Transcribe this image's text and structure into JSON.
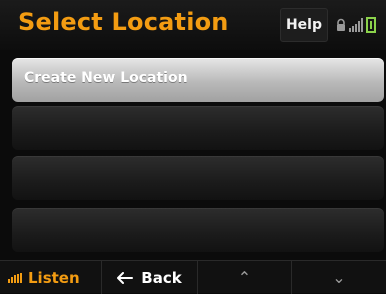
{
  "header": {
    "title": "Select Location",
    "help_label": "Help",
    "status_icons": [
      "lock-icon",
      "signal-icon",
      "battery-icon"
    ]
  },
  "list": {
    "items": [
      {
        "label": "Create New Location",
        "selected": true
      },
      {
        "label": "",
        "selected": false
      },
      {
        "label": "",
        "selected": false
      },
      {
        "label": "",
        "selected": false
      }
    ]
  },
  "bottom_bar": {
    "listen_label": "Listen",
    "back_label": "Back"
  },
  "colors": {
    "accent": "#f39c12",
    "battery": "#8bd24b"
  }
}
